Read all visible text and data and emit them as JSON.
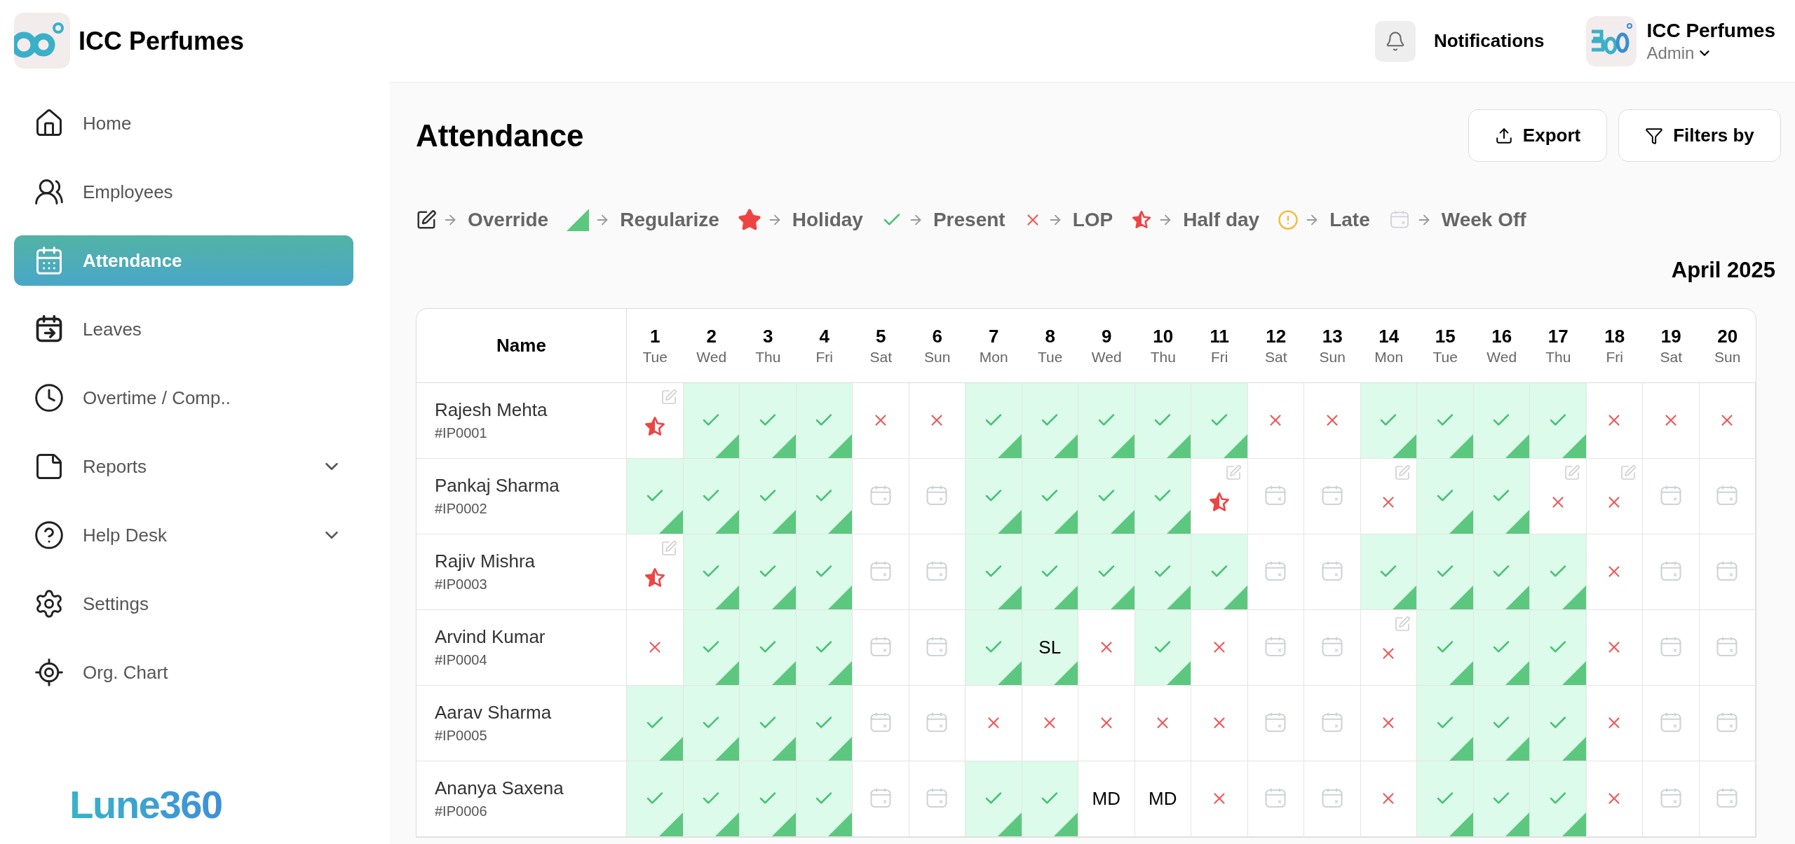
{
  "brand": {
    "name": "ICC Perfumes",
    "footer_logo": "Lune360"
  },
  "sidebar": {
    "items": [
      {
        "label": "Home",
        "selected": false,
        "expandable": false
      },
      {
        "label": "Employees",
        "selected": false,
        "expandable": false
      },
      {
        "label": "Attendance",
        "selected": true,
        "expandable": false
      },
      {
        "label": "Leaves",
        "selected": false,
        "expandable": false
      },
      {
        "label": "Overtime / Comp..",
        "selected": false,
        "expandable": false
      },
      {
        "label": "Reports",
        "selected": false,
        "expandable": true
      },
      {
        "label": "Help Desk",
        "selected": false,
        "expandable": true
      },
      {
        "label": "Settings",
        "selected": false,
        "expandable": false
      },
      {
        "label": "Org. Chart",
        "selected": false,
        "expandable": false
      }
    ]
  },
  "header": {
    "notifications": "Notifications",
    "user": {
      "name": "ICC Perfumes",
      "role": "Admin"
    }
  },
  "page": {
    "title": "Attendance",
    "buttons": [
      {
        "kind": "export",
        "label": "Export"
      },
      {
        "kind": "filter",
        "label": "Filters by"
      }
    ]
  },
  "legend": [
    {
      "kind": "override",
      "label": "Override"
    },
    {
      "kind": "regularize",
      "label": "Regularize"
    },
    {
      "kind": "holiday",
      "label": "Holiday"
    },
    {
      "kind": "present",
      "label": "Present"
    },
    {
      "kind": "lop",
      "label": "LOP"
    },
    {
      "kind": "half_day",
      "label": "Half day"
    },
    {
      "kind": "late",
      "label": "Late"
    },
    {
      "kind": "week_off",
      "label": "Week Off"
    }
  ],
  "month": "April 2025",
  "table": {
    "name_header": "Name",
    "columns": [
      {
        "date": "1",
        "day": "Tue"
      },
      {
        "date": "2",
        "day": "Wed"
      },
      {
        "date": "3",
        "day": "Thu"
      },
      {
        "date": "4",
        "day": "Fri"
      },
      {
        "date": "5",
        "day": "Sat"
      },
      {
        "date": "6",
        "day": "Sun"
      },
      {
        "date": "7",
        "day": "Mon"
      },
      {
        "date": "8",
        "day": "Tue"
      },
      {
        "date": "9",
        "day": "Wed"
      },
      {
        "date": "10",
        "day": "Thu"
      },
      {
        "date": "11",
        "day": "Fri"
      },
      {
        "date": "12",
        "day": "Sat"
      },
      {
        "date": "13",
        "day": "Sun"
      },
      {
        "date": "14",
        "day": "Mon"
      },
      {
        "date": "15",
        "day": "Tue"
      },
      {
        "date": "16",
        "day": "Wed"
      },
      {
        "date": "17",
        "day": "Thu"
      },
      {
        "date": "18",
        "day": "Fri"
      },
      {
        "date": "19",
        "day": "Sat"
      },
      {
        "date": "20",
        "day": "Sun"
      }
    ],
    "rows": [
      {
        "name": "Rajesh Mehta",
        "id": "#IP0001",
        "cells": [
          {
            "kind": "half_day",
            "regularized": false,
            "override": true
          },
          {
            "kind": "present",
            "regularized": true,
            "override": false
          },
          {
            "kind": "present",
            "regularized": true,
            "override": false
          },
          {
            "kind": "present",
            "regularized": true,
            "override": false
          },
          {
            "kind": "lop",
            "regularized": false,
            "override": false
          },
          {
            "kind": "lop",
            "regularized": false,
            "override": false
          },
          {
            "kind": "present",
            "regularized": true,
            "override": false
          },
          {
            "kind": "present",
            "regularized": true,
            "override": false
          },
          {
            "kind": "present",
            "regularized": true,
            "override": false
          },
          {
            "kind": "present",
            "regularized": true,
            "override": false
          },
          {
            "kind": "present",
            "regularized": true,
            "override": false
          },
          {
            "kind": "lop",
            "regularized": false,
            "override": false
          },
          {
            "kind": "lop",
            "regularized": false,
            "override": false
          },
          {
            "kind": "present",
            "regularized": true,
            "override": false
          },
          {
            "kind": "present",
            "regularized": true,
            "override": false
          },
          {
            "kind": "present",
            "regularized": true,
            "override": false
          },
          {
            "kind": "present",
            "regularized": true,
            "override": false
          },
          {
            "kind": "lop",
            "regularized": false,
            "override": false
          },
          {
            "kind": "lop",
            "regularized": false,
            "override": false
          },
          {
            "kind": "lop",
            "regularized": false,
            "override": false
          }
        ]
      },
      {
        "name": "Pankaj Sharma",
        "id": "#IP0002",
        "cells": [
          {
            "kind": "present",
            "regularized": true,
            "override": false
          },
          {
            "kind": "present",
            "regularized": true,
            "override": false
          },
          {
            "kind": "present",
            "regularized": true,
            "override": false
          },
          {
            "kind": "present",
            "regularized": true,
            "override": false
          },
          {
            "kind": "week_off",
            "regularized": false,
            "override": false
          },
          {
            "kind": "week_off",
            "regularized": false,
            "override": false
          },
          {
            "kind": "present",
            "regularized": true,
            "override": false
          },
          {
            "kind": "present",
            "regularized": true,
            "override": false
          },
          {
            "kind": "present",
            "regularized": true,
            "override": false
          },
          {
            "kind": "present",
            "regularized": true,
            "override": false
          },
          {
            "kind": "half_day",
            "regularized": false,
            "override": true
          },
          {
            "kind": "week_off",
            "regularized": false,
            "override": false
          },
          {
            "kind": "week_off",
            "regularized": false,
            "override": false
          },
          {
            "kind": "lop",
            "regularized": false,
            "override": true
          },
          {
            "kind": "present",
            "regularized": true,
            "override": false
          },
          {
            "kind": "present",
            "regularized": true,
            "override": false
          },
          {
            "kind": "lop",
            "regularized": false,
            "override": true
          },
          {
            "kind": "lop",
            "regularized": false,
            "override": true
          },
          {
            "kind": "week_off",
            "regularized": false,
            "override": false
          },
          {
            "kind": "week_off",
            "regularized": false,
            "override": false
          }
        ]
      },
      {
        "name": "Rajiv Mishra",
        "id": "#IP0003",
        "cells": [
          {
            "kind": "half_day",
            "regularized": false,
            "override": true
          },
          {
            "kind": "present",
            "regularized": true,
            "override": false
          },
          {
            "kind": "present",
            "regularized": true,
            "override": false
          },
          {
            "kind": "present",
            "regularized": true,
            "override": false
          },
          {
            "kind": "week_off",
            "regularized": false,
            "override": false
          },
          {
            "kind": "week_off",
            "regularized": false,
            "override": false
          },
          {
            "kind": "present",
            "regularized": true,
            "override": false
          },
          {
            "kind": "present",
            "regularized": true,
            "override": false
          },
          {
            "kind": "present",
            "regularized": true,
            "override": false
          },
          {
            "kind": "present",
            "regularized": true,
            "override": false
          },
          {
            "kind": "present",
            "regularized": true,
            "override": false
          },
          {
            "kind": "week_off",
            "regularized": false,
            "override": false
          },
          {
            "kind": "week_off",
            "regularized": false,
            "override": false
          },
          {
            "kind": "present",
            "regularized": true,
            "override": false
          },
          {
            "kind": "present",
            "regularized": true,
            "override": false
          },
          {
            "kind": "present",
            "regularized": true,
            "override": false
          },
          {
            "kind": "present",
            "regularized": true,
            "override": false
          },
          {
            "kind": "lop",
            "regularized": false,
            "override": false
          },
          {
            "kind": "week_off",
            "regularized": false,
            "override": false
          },
          {
            "kind": "week_off",
            "regularized": false,
            "override": false
          }
        ]
      },
      {
        "name": "Arvind Kumar",
        "id": "#IP0004",
        "cells": [
          {
            "kind": "lop",
            "regularized": false,
            "override": false
          },
          {
            "kind": "present",
            "regularized": true,
            "override": false
          },
          {
            "kind": "present",
            "regularized": true,
            "override": false
          },
          {
            "kind": "present",
            "regularized": true,
            "override": false
          },
          {
            "kind": "week_off",
            "regularized": false,
            "override": false
          },
          {
            "kind": "week_off",
            "regularized": false,
            "override": false
          },
          {
            "kind": "present",
            "regularized": true,
            "override": false
          },
          {
            "kind": "leave",
            "text": "SL",
            "regularized": true,
            "override": false
          },
          {
            "kind": "lop",
            "regularized": false,
            "override": false
          },
          {
            "kind": "present",
            "regularized": true,
            "override": false
          },
          {
            "kind": "lop",
            "regularized": false,
            "override": false
          },
          {
            "kind": "week_off",
            "regularized": false,
            "override": false
          },
          {
            "kind": "week_off",
            "regularized": false,
            "override": false
          },
          {
            "kind": "lop",
            "regularized": false,
            "override": true
          },
          {
            "kind": "present",
            "regularized": true,
            "override": false
          },
          {
            "kind": "present",
            "regularized": true,
            "override": false
          },
          {
            "kind": "present",
            "regularized": true,
            "override": false
          },
          {
            "kind": "lop",
            "regularized": false,
            "override": false
          },
          {
            "kind": "week_off",
            "regularized": false,
            "override": false
          },
          {
            "kind": "week_off",
            "regularized": false,
            "override": false
          }
        ]
      },
      {
        "name": "Aarav Sharma",
        "id": "#IP0005",
        "cells": [
          {
            "kind": "present",
            "regularized": true,
            "override": false
          },
          {
            "kind": "present",
            "regularized": true,
            "override": false
          },
          {
            "kind": "present",
            "regularized": true,
            "override": false
          },
          {
            "kind": "present",
            "regularized": true,
            "override": false
          },
          {
            "kind": "week_off",
            "regularized": false,
            "override": false
          },
          {
            "kind": "week_off",
            "regularized": false,
            "override": false
          },
          {
            "kind": "lop",
            "regularized": false,
            "override": false
          },
          {
            "kind": "lop",
            "regularized": false,
            "override": false
          },
          {
            "kind": "lop",
            "regularized": false,
            "override": false
          },
          {
            "kind": "lop",
            "regularized": false,
            "override": false
          },
          {
            "kind": "lop",
            "regularized": false,
            "override": false
          },
          {
            "kind": "week_off",
            "regularized": false,
            "override": false
          },
          {
            "kind": "week_off",
            "regularized": false,
            "override": false
          },
          {
            "kind": "lop",
            "regularized": false,
            "override": false
          },
          {
            "kind": "present",
            "regularized": true,
            "override": false
          },
          {
            "kind": "present",
            "regularized": true,
            "override": false
          },
          {
            "kind": "present",
            "regularized": true,
            "override": false
          },
          {
            "kind": "lop",
            "regularized": false,
            "override": false
          },
          {
            "kind": "week_off",
            "regularized": false,
            "override": false
          },
          {
            "kind": "week_off",
            "regularized": false,
            "override": false
          }
        ]
      },
      {
        "name": "Ananya Saxena",
        "id": "#IP0006",
        "cells": [
          {
            "kind": "present",
            "regularized": true,
            "override": false
          },
          {
            "kind": "present",
            "regularized": true,
            "override": false
          },
          {
            "kind": "present",
            "regularized": true,
            "override": false
          },
          {
            "kind": "present",
            "regularized": true,
            "override": false
          },
          {
            "kind": "week_off",
            "regularized": false,
            "override": false
          },
          {
            "kind": "week_off",
            "regularized": false,
            "override": false
          },
          {
            "kind": "present",
            "regularized": true,
            "override": false
          },
          {
            "kind": "present",
            "regularized": true,
            "override": false
          },
          {
            "kind": "leave",
            "text": "MD",
            "regularized": false,
            "override": false
          },
          {
            "kind": "leave",
            "text": "MD",
            "regularized": false,
            "override": false
          },
          {
            "kind": "lop",
            "regularized": false,
            "override": false
          },
          {
            "kind": "week_off",
            "regularized": false,
            "override": false
          },
          {
            "kind": "week_off",
            "regularized": false,
            "override": false
          },
          {
            "kind": "lop",
            "regularized": false,
            "override": false
          },
          {
            "kind": "present",
            "regularized": true,
            "override": false
          },
          {
            "kind": "present",
            "regularized": true,
            "override": false
          },
          {
            "kind": "present",
            "regularized": true,
            "override": false
          },
          {
            "kind": "lop",
            "regularized": false,
            "override": false
          },
          {
            "kind": "week_off",
            "regularized": false,
            "override": false
          },
          {
            "kind": "week_off",
            "regularized": false,
            "override": false
          }
        ]
      }
    ]
  }
}
